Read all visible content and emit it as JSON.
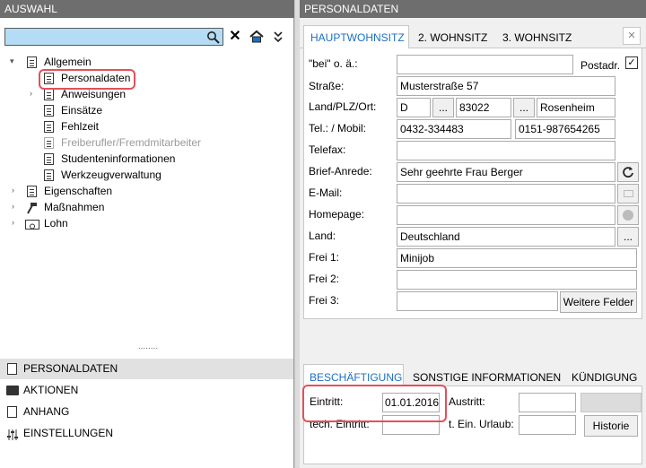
{
  "left": {
    "title": "AUSWAHL",
    "search_value": "",
    "tree": [
      {
        "label": "Allgemein",
        "expander": "▾",
        "icon": "clipboard-icon"
      },
      {
        "label": "Personaldaten",
        "icon": "document-icon",
        "selected": true
      },
      {
        "label": "Anweisungen",
        "expander": "›",
        "icon": "documents-icon"
      },
      {
        "label": "Einsätze",
        "icon": "form-icon"
      },
      {
        "label": "Fehlzeit",
        "icon": "form-icon"
      },
      {
        "label": "Freiberufler/Fremdmitarbeiter",
        "icon": "form-icon",
        "disabled": true
      },
      {
        "label": "Studenteninformationen",
        "icon": "form-icon"
      },
      {
        "label": "Werkzeugverwaltung",
        "icon": "form-icon"
      },
      {
        "label": "Eigenschaften",
        "expander": "›",
        "icon": "clipboard-icon"
      },
      {
        "label": "Maßnahmen",
        "expander": "›",
        "icon": "hammer-icon"
      },
      {
        "label": "Lohn",
        "expander": "›",
        "icon": "money-icon"
      }
    ],
    "splitter": "........",
    "accordion": [
      {
        "label": "PERSONALDATEN",
        "icon": "personnel-file-icon"
      },
      {
        "label": "AKTIONEN",
        "icon": "folder-icon"
      },
      {
        "label": "ANHANG",
        "icon": "attachment-icon"
      },
      {
        "label": "EINSTELLUNGEN",
        "icon": "sliders-icon"
      }
    ]
  },
  "right": {
    "title": "PERSONALDATEN",
    "tabs": [
      "HAUPTWOHNSITZ",
      "2. WOHNSITZ",
      "3. WOHNSITZ"
    ],
    "form": {
      "bei_label": "\"bei\" o. ä.:",
      "bei_value": "",
      "postadr_label": "Postadr.",
      "postadr_checked": "✓",
      "strasse_label": "Straße:",
      "strasse_value": "Musterstraße 57",
      "land_plz_ort_label": "Land/PLZ/Ort:",
      "land_value": "D",
      "plz_value": "83022",
      "ort_value": "Rosenheim",
      "ellipsis": "...",
      "tel_label": "Tel.: / Mobil:",
      "tel_value": "0432-334483",
      "mobil_value": "0151-987654265",
      "telefax_label": "Telefax:",
      "telefax_value": "",
      "anrede_label": "Brief-Anrede:",
      "anrede_value": "Sehr geehrte Frau Berger",
      "email_label": "E-Mail:",
      "email_value": "",
      "homepage_label": "Homepage:",
      "homepage_value": "",
      "land_label": "Land:",
      "land_name_value": "Deutschland",
      "frei1_label": "Frei 1:",
      "frei1_value": "Minijob",
      "frei2_label": "Frei 2:",
      "frei2_value": "",
      "frei3_label": "Frei 3:",
      "frei3_value": "",
      "weitere_felder": "Weitere Felder"
    },
    "bottom_tabs": [
      "BESCHÄFTIGUNG",
      "SONSTIGE INFORMATIONEN",
      "KÜNDIGUNG"
    ],
    "employment": {
      "eintritt_label": "Eintritt:",
      "eintritt_value": "01.01.2016",
      "austritt_label": "Austritt:",
      "austritt_value": "",
      "tech_eintritt_label": "tech. Eintritt:",
      "tech_eintritt_value": "",
      "urlaub_label": "t. Ein. Urlaub:",
      "urlaub_value": "",
      "historie": "Historie"
    }
  },
  "colors": {
    "accent": "#1c6fc1",
    "highlight": "#e3505a",
    "header": "#6e6e6e",
    "search_bg": "#b4dcf5"
  }
}
